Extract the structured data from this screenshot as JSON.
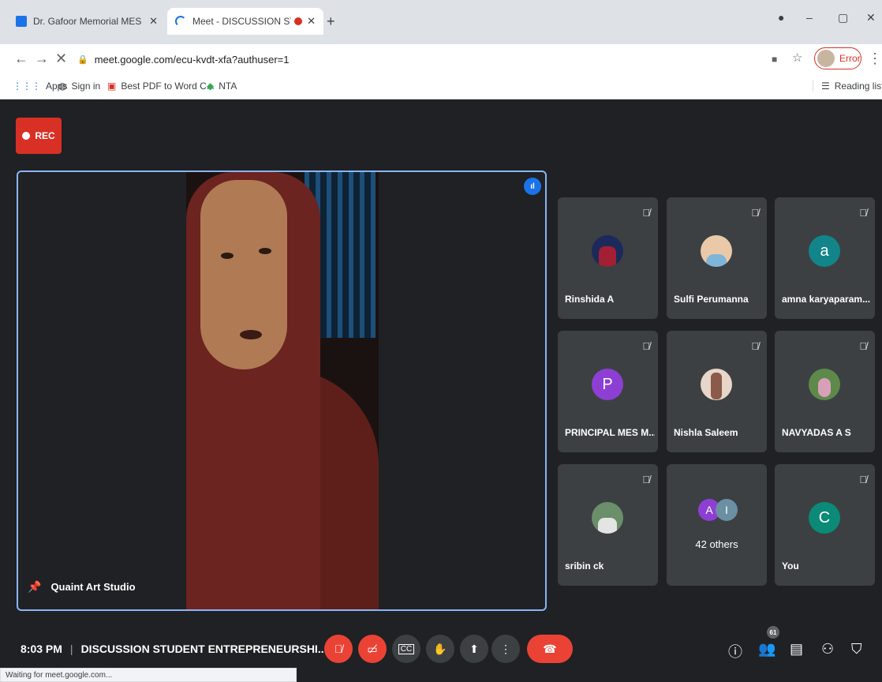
{
  "browser": {
    "tabs": [
      {
        "title": "Dr. Gafoor Memorial MES Mamp"
      },
      {
        "title": "Meet - DISCUSSION STUDEN"
      }
    ],
    "url": "meet.google.com/ecu-kvdt-xfa?authuser=1",
    "profile_label": "Error",
    "bookmarks": {
      "apps": "Apps",
      "signin": "Sign in",
      "pdf": "Best PDF to Word C...",
      "nta": "NTA",
      "reading_list": "Reading list"
    },
    "status": "Waiting for meet.google.com..."
  },
  "meet": {
    "rec_label": "REC",
    "speaker_name": "Quaint Art Studio",
    "participants": [
      {
        "name": "Rinshida A",
        "initial": "",
        "color": ""
      },
      {
        "name": "Sulfi Perumanna",
        "initial": "",
        "color": ""
      },
      {
        "name": "amna karyaparam...",
        "initial": "a",
        "color": "#12858a"
      },
      {
        "name": "PRINCIPAL MES M...",
        "initial": "P",
        "color": "#8e3fd3"
      },
      {
        "name": "Nishla Saleem",
        "initial": "",
        "color": ""
      },
      {
        "name": "NAVYADAS A S",
        "initial": "",
        "color": ""
      },
      {
        "name": "sribin ck",
        "initial": "",
        "color": ""
      },
      {
        "name": "You",
        "initial": "C",
        "color": "#0b8a77"
      }
    ],
    "others_label": "42 others",
    "others_initials": [
      "A",
      "I"
    ],
    "time": "8:03 PM",
    "meeting_title": "DISCUSSION STUDENT ENTREPRENEURSHI...",
    "participant_count": "61"
  }
}
